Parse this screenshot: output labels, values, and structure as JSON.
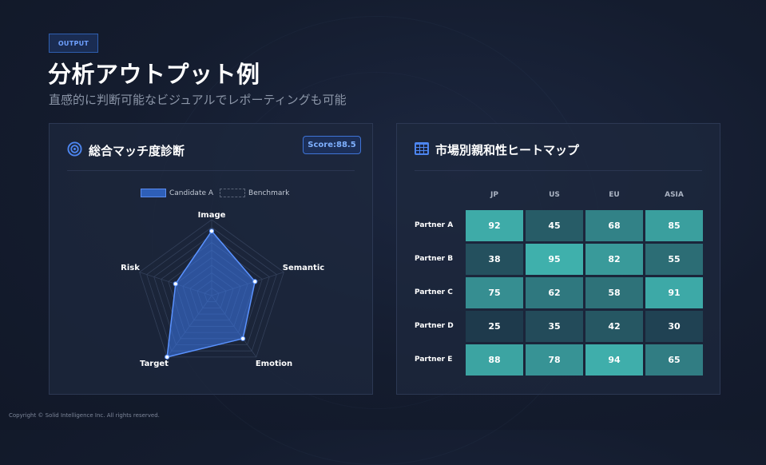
{
  "badge": "OUTPUT",
  "title": "分析アウトプット例",
  "subtitle": "直感的に判断可能なビジュアルでレポーティングも可能",
  "left_panel": {
    "title": "総合マッチ度診断",
    "icon": "target-icon",
    "score": "Score:88.5",
    "legend": {
      "candidate": "Candidate A",
      "benchmark": "Benchmark"
    },
    "accent": "#4d86f0"
  },
  "chart_data": [
    {
      "type": "radar",
      "axes": [
        "Image",
        "Semantic",
        "Emotion",
        "Target",
        "Risk"
      ],
      "rmax": 100,
      "grid_levels": 10,
      "series": [
        {
          "name": "Candidate A",
          "values": [
            85,
            60,
            70,
            100,
            50
          ]
        },
        {
          "name": "Benchmark",
          "values": []
        }
      ]
    },
    {
      "type": "heatmap",
      "columns": [
        "JP",
        "US",
        "EU",
        "ASIA"
      ],
      "rows": [
        "Partner A",
        "Partner B",
        "Partner C",
        "Partner D",
        "Partner E"
      ],
      "values": [
        [
          92,
          45,
          68,
          85
        ],
        [
          38,
          95,
          82,
          55
        ],
        [
          75,
          62,
          58,
          91
        ],
        [
          25,
          35,
          42,
          30
        ],
        [
          88,
          78,
          94,
          65
        ]
      ]
    }
  ],
  "right_panel": {
    "title": "市場別親和性ヒートマップ",
    "icon": "grid-table-icon",
    "colors": {
      "low": "#1e3a4c",
      "high": "#3fb0ac"
    }
  },
  "footer": "Copyright © Solid Intelligence Inc. All rights reserved."
}
